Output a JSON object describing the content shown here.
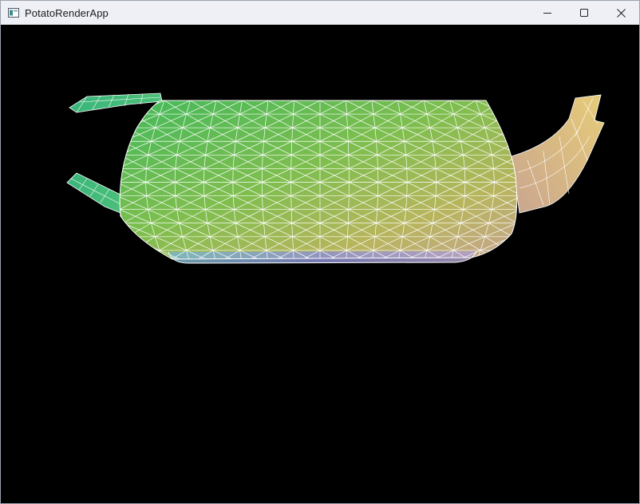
{
  "window": {
    "title": "PotatoRenderApp",
    "icon": "app-window-icon"
  },
  "caption_buttons": {
    "minimize": "minimize-icon",
    "maximize": "maximize-icon",
    "close": "close-icon"
  },
  "viewport": {
    "background": "#000000",
    "wire_color": "#ffffff",
    "model": "wireframe-teapot-mesh",
    "gradient_colors": [
      "#4fbf5a",
      "#9cc24a",
      "#d9b97a",
      "#c9a8a8",
      "#9aa3d8"
    ]
  }
}
